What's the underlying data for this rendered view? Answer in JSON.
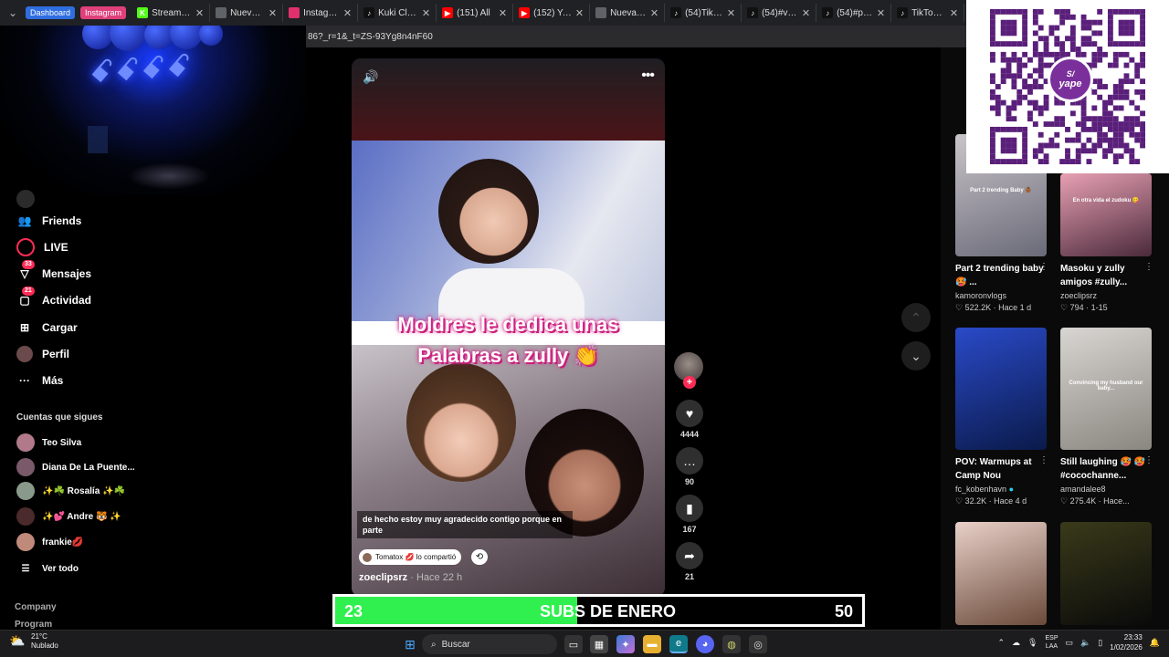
{
  "browser": {
    "tabs": [
      {
        "label": "Stream - Kick",
        "icon": "kick-icon",
        "color": "#53fc18",
        "glyph": "K"
      },
      {
        "label": "Nueva pestaña",
        "icon": "page-icon",
        "color": "#5f6368",
        "glyph": ""
      },
      {
        "label": "Instagram",
        "icon": "instagram-icon",
        "color": "#e1306c",
        "glyph": ""
      },
      {
        "label": "Kuki Clips 🍪",
        "icon": "tiktok-icon",
        "color": "#111111",
        "glyph": "♪"
      },
      {
        "label": "(151) All",
        "icon": "youtube-icon",
        "color": "#ff0000",
        "glyph": "▶"
      },
      {
        "label": "(152) YouTube",
        "icon": "youtube-icon",
        "color": "#ff0000",
        "glyph": "▶"
      },
      {
        "label": "Nueva pestaña",
        "icon": "page-icon",
        "color": "#5f6368",
        "glyph": ""
      },
      {
        "label": "(54)TikTok - M",
        "icon": "tiktok-icon",
        "color": "#111111",
        "glyph": "♪"
      },
      {
        "label": "(54)#viral #p",
        "icon": "tiktok-icon",
        "color": "#111111",
        "glyph": "♪"
      },
      {
        "label": "(54)#paratii",
        "icon": "tiktok-icon",
        "color": "#111111",
        "glyph": "♪"
      },
      {
        "label": "TikTok - Mak",
        "icon": "tiktok-icon",
        "color": "#111111",
        "glyph": "♪"
      }
    ],
    "pills": {
      "dashboard": "Dashboard",
      "instagram": "Instagram"
    },
    "url": "86?_r=1&_t=ZS-93Yg8n4nF60"
  },
  "sidebar": {
    "items": [
      {
        "label": "Friends",
        "icon": "friends-icon",
        "glyph": "👥",
        "badge": ""
      },
      {
        "label": "LIVE",
        "icon": "live-icon",
        "glyph": "",
        "badge": ""
      },
      {
        "label": "Mensajes",
        "icon": "messages-icon",
        "glyph": "▽",
        "badge": "33"
      },
      {
        "label": "Actividad",
        "icon": "activity-icon",
        "glyph": "▢",
        "badge": "21"
      },
      {
        "label": "Cargar",
        "icon": "upload-icon",
        "glyph": "⊞",
        "badge": ""
      },
      {
        "label": "Perfil",
        "icon": "profile-avatar-icon",
        "glyph": "",
        "badge": ""
      },
      {
        "label": "Más",
        "icon": "more-dots-icon",
        "glyph": "···",
        "badge": ""
      }
    ],
    "following_title": "Cuentas que sigues",
    "accounts": [
      {
        "name": "Teo Silva",
        "color": "#b07a8a"
      },
      {
        "name": "Diana De La Puente...",
        "color": "#7a5a6a"
      },
      {
        "name": "✨☘️ Rosalía ✨☘️",
        "color": "#8a9a8a"
      },
      {
        "name": "✨💕 Andre 🐯 ✨",
        "color": "#4a2a2a"
      },
      {
        "name": "frankie💋",
        "color": "#c08a7a"
      }
    ],
    "see_all": "Ver todo",
    "footer": {
      "company": "Company",
      "program": "Program"
    }
  },
  "video": {
    "caption_line1": "Moldres le dedica unas",
    "caption_line2": "Palabras a zully 👏",
    "subtitle": "de hecho estoy muy agradecido contigo porque en parte",
    "shared_by": "Tomatox 💋 lo compartió",
    "author": "zoeclipsrz",
    "posted": "· Hace 22 h",
    "actions": {
      "likes": "4444",
      "comments": "90",
      "saves": "167",
      "shares": "21"
    }
  },
  "recommendations": [
    {
      "title": "Part 2 trending baby 🥵 ...",
      "author": "kamoronvlogs",
      "verified": false,
      "likes": "522.2K",
      "age": "Hace 1 d",
      "thumb_text": "Part 2 trending Baby 👶🏾",
      "c1": "#c9c4c9",
      "c2": "#6a6a78"
    },
    {
      "title": "Masoku y zully amigos #zully...",
      "author": "zoeclipsrz",
      "verified": false,
      "likes": "794",
      "age": "1-15",
      "thumb_text": "En otra vida el zudoku 😋",
      "c1": "#e8a0b4",
      "c2": "#4a2a3a"
    },
    {
      "title": "POV: Warmups at Camp Nou",
      "author": "fc_kobenhavn",
      "verified": true,
      "likes": "32.2K",
      "age": "Hace 4 d",
      "thumb_text": "",
      "c1": "#2a4ac8",
      "c2": "#0a1a4a"
    },
    {
      "title": "Still laughing 🥵 🥵 #cocochanne...",
      "author": "amandalee8",
      "verified": false,
      "likes": "275.4K",
      "age": "Hace...",
      "thumb_text": "Convincing my husband our baby...",
      "c1": "#d8d6d2",
      "c2": "#8a8680"
    },
    {
      "title": "",
      "author": "",
      "verified": false,
      "likes": "",
      "age": "",
      "thumb_text": "",
      "c1": "#e8d0c8",
      "c2": "#6a4a3a"
    },
    {
      "title": "",
      "author": "",
      "verified": false,
      "likes": "",
      "age": "",
      "thumb_text": "",
      "c1": "#3a3a1a",
      "c2": "#0a0a0a"
    }
  ],
  "subs_goal": {
    "current": "23",
    "label": "SUBS DE ENERO",
    "goal": "50",
    "progress": 0.46,
    "fill_color": "#2ff04e"
  },
  "taskbar": {
    "weather_temp": "21°C",
    "weather_desc": "Nublado",
    "search_placeholder": "Buscar",
    "lang1": "ESP",
    "lang2": "LAA",
    "time": "23:33",
    "date": "1/02/2026"
  }
}
